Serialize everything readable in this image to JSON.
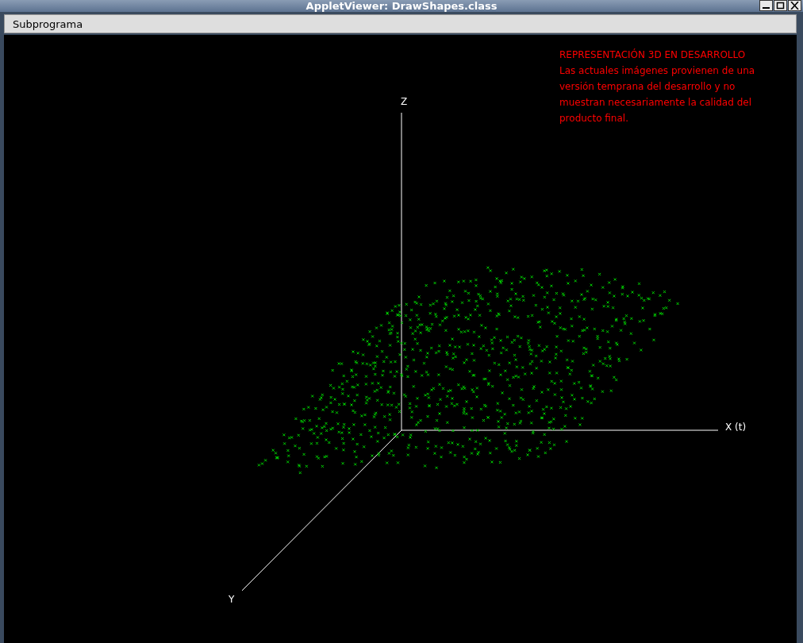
{
  "window": {
    "title": "AppletViewer: DrawShapes.class"
  },
  "menu": [
    {
      "label": "Subprograma"
    }
  ],
  "notice": {
    "heading": "REPRESENTACIÓN 3D EN DESARROLLO",
    "lines": [
      "Las actuales imágenes provienen de una",
      "versión temprana del desarrollo y no",
      "muestran necesariamente la calidad del",
      "producto final."
    ]
  },
  "axes": {
    "z": "Z",
    "x": "X (t)",
    "y": "Y"
  }
}
